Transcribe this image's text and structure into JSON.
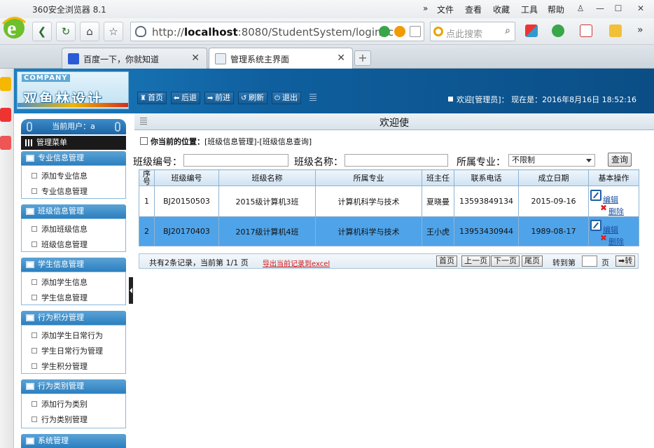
{
  "browser": {
    "app_title": "360安全浏览器 8.1",
    "menu": [
      "»",
      "文件",
      "查看",
      "收藏",
      "工具",
      "帮助"
    ],
    "url_host": "localhost",
    "url_prefix": "http://",
    "url_rest": ":8080/StudentSystem/login/lc",
    "search_placeholder": "点此搜索",
    "tabs": [
      {
        "label": "百度一下，你就知道",
        "active": false
      },
      {
        "label": "管理系统主界面",
        "active": true
      }
    ],
    "new_tab": "+"
  },
  "header": {
    "company": "COMPANY",
    "brand": "双鱼林设计",
    "nav": [
      {
        "icon": "home-icon",
        "glyph": "♜",
        "label": "首页"
      },
      {
        "icon": "back-icon",
        "glyph": "⬅",
        "label": "后退"
      },
      {
        "icon": "forward-icon",
        "glyph": "➡",
        "label": "前进"
      },
      {
        "icon": "refresh-icon",
        "glyph": "↺",
        "label": "刷新"
      },
      {
        "icon": "power-icon",
        "glyph": "⏻",
        "label": "退出"
      }
    ],
    "welcome": "欢迎[管理员]：  现在是：2016年8月16日 18:52:16"
  },
  "sidebar": {
    "current_user": "当前用户：a",
    "manage_menu": "管理菜单",
    "groups": [
      {
        "title": "专业信息管理",
        "items": [
          "添加专业信息",
          "专业信息管理"
        ]
      },
      {
        "title": "班级信息管理",
        "items": [
          "添加班级信息",
          "班级信息管理"
        ]
      },
      {
        "title": "学生信息管理",
        "items": [
          "添加学生信息",
          "学生信息管理"
        ]
      },
      {
        "title": "行为积分管理",
        "items": [
          "添加学生日常行为",
          "学生日常行为管理",
          "学生积分管理"
        ]
      },
      {
        "title": "行为类别管理",
        "items": [
          "添加行为类别",
          "行为类别管理"
        ]
      },
      {
        "title": "系统管理",
        "items": []
      }
    ]
  },
  "main": {
    "title": "欢迎使",
    "location_label": "你当前的位置：",
    "location_path": "[班级信息管理]-[班级信息查询]",
    "filter": {
      "class_no_label": "班级编号：",
      "class_no_value": "",
      "class_name_label": "班级名称：",
      "class_name_value": "",
      "major_label": "所属专业：",
      "major_value": "不限制",
      "query_button": "查询"
    },
    "table": {
      "headers": [
        "序号",
        "班级编号",
        "班级名称",
        "所属专业",
        "班主任",
        "联系电话",
        "成立日期",
        "基本操作"
      ],
      "rows": [
        [
          "1",
          "BJ20150503",
          "2015级计算机3班",
          "计算机科学与技术",
          "夏晓曼",
          "13593849134",
          "2015-09-16"
        ],
        [
          "2",
          "BJ20170403",
          "2017级计算机4班",
          "计算机科学与技术",
          "王小虎",
          "13953430944",
          "1989-08-17"
        ]
      ],
      "edit_label": "编辑",
      "delete_label": "删除"
    },
    "pager": {
      "summary": "共有2条记录，当前第 1/1 页",
      "export": "导出当前记录到excel",
      "first": "首页",
      "prev": "上一页",
      "next": "下一页",
      "last": "尾页",
      "goto_label": "转到第",
      "page_value": "",
      "page_unit": "页",
      "go_button": "➡转"
    }
  }
}
